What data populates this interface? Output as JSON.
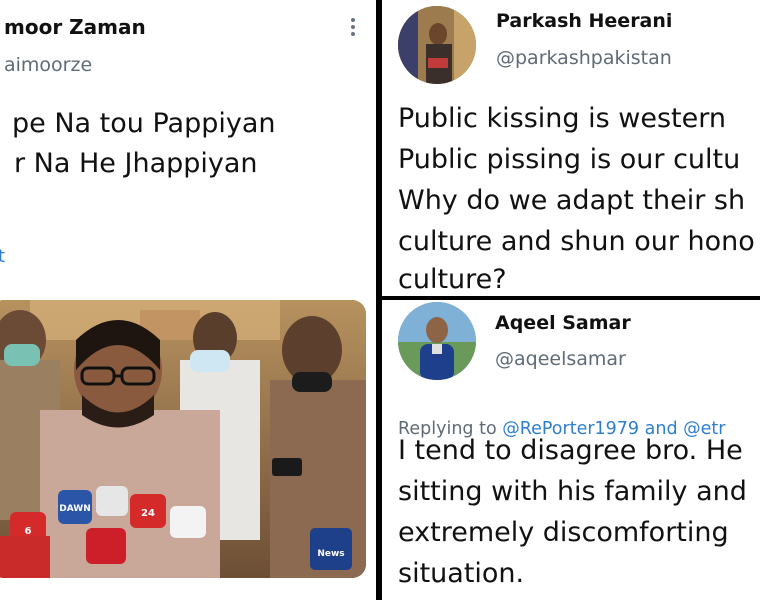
{
  "left_tweet": {
    "display_name": "Taimoor Zaman",
    "display_name_visible": "moor Zaman",
    "handle": "@taimoorze",
    "handle_visible": "aimoorze",
    "text_line1": "pe Na tou Pappiyan",
    "text_line2": "r Na He Jhappiyan",
    "partial_link": "t",
    "photo": {
      "mic_labels": [
        "DAWN",
        "24",
        "6"
      ],
      "logo_label": "News"
    }
  },
  "top_right_tweet": {
    "display_name": "Parkash Heerani",
    "handle": "@parkashpakistan",
    "text_lines": [
      "Public kissing is western",
      "Public pissing is our cultu",
      "Why do we adapt their sh",
      "culture and shun our hono",
      "culture?"
    ]
  },
  "bottom_right_tweet": {
    "display_name": "Aqeel Samar",
    "handle": "@aqeelsamar",
    "replying_prefix": "Replying to ",
    "replying_mentions": "@RePorter1979 and @etr",
    "text_lines": [
      "I tend to disagree bro. He",
      "sitting with his family and",
      "extremely discomforting",
      "situation."
    ]
  },
  "colors": {
    "divider": "#000000",
    "link_blue": "#2f7fd0",
    "handle_gray": "#5f6b76"
  }
}
